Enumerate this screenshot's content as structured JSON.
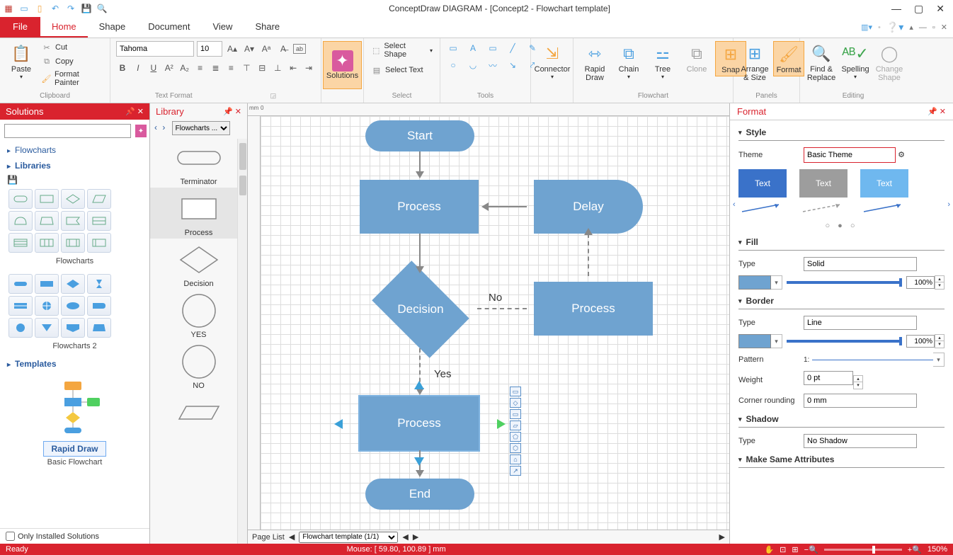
{
  "app_title": "ConceptDraw DIAGRAM - [Concept2 - Flowchart template]",
  "menu": {
    "file": "File",
    "home": "Home",
    "shape": "Shape",
    "document": "Document",
    "view": "View",
    "share": "Share"
  },
  "ribbon": {
    "paste": "Paste",
    "cut": "Cut",
    "copy": "Copy",
    "format_painter": "Format Painter",
    "clipboard": "Clipboard",
    "text_format": "Text Format",
    "font_name": "Tahoma",
    "font_size": "10",
    "solutions": "Solutions",
    "select_shape": "Select Shape",
    "select_text": "Select Text",
    "select": "Select",
    "tools": "Tools",
    "connector": "Connector",
    "rapid_draw": "Rapid\nDraw",
    "chain": "Chain",
    "tree": "Tree",
    "clone": "Clone",
    "snap": "Snap",
    "flowchart": "Flowchart",
    "arrange_size": "Arrange\n& Size",
    "format": "Format",
    "panels": "Panels",
    "find_replace": "Find &\nReplace",
    "spelling": "Spelling",
    "change_shape": "Change\nShape",
    "editing": "Editing"
  },
  "solutions_panel": {
    "title": "Solutions",
    "flowcharts": "Flowcharts",
    "libraries": "Libraries",
    "flowcharts_lib": "Flowcharts",
    "flowcharts2_lib": "Flowcharts 2",
    "templates": "Templates",
    "rapid_draw": "Rapid Draw",
    "basic_flowchart": "Basic Flowchart",
    "only_installed": "Only Installed Solutions"
  },
  "library_panel": {
    "title": "Library",
    "dropdown": "Flowcharts ...",
    "items": [
      "Terminator",
      "Process",
      "Decision",
      "YES",
      "NO"
    ]
  },
  "canvas": {
    "ruler_unit": "mm",
    "start": "Start",
    "process": "Process",
    "delay": "Delay",
    "decision": "Decision",
    "no": "No",
    "yes": "Yes",
    "end": "End",
    "page_list": "Page List",
    "page_dropdown": "Flowchart template (1/1)"
  },
  "format_panel": {
    "title": "Format",
    "style": "Style",
    "theme": "Theme",
    "theme_value": "Basic Theme",
    "text": "Text",
    "fill": "Fill",
    "type": "Type",
    "fill_type_value": "Solid",
    "fill_pct": "100%",
    "border": "Border",
    "border_type_value": "Line",
    "border_pct": "100%",
    "pattern": "Pattern",
    "pattern_value": "1:",
    "weight": "Weight",
    "weight_value": "0 pt",
    "corner_rounding": "Corner rounding",
    "corner_value": "0 mm",
    "shadow": "Shadow",
    "shadow_type_value": "No Shadow",
    "make_same": "Make Same Attributes"
  },
  "status": {
    "ready": "Ready",
    "mouse": "Mouse: [ 59.80, 100.89 ] mm",
    "zoom": "150%"
  }
}
